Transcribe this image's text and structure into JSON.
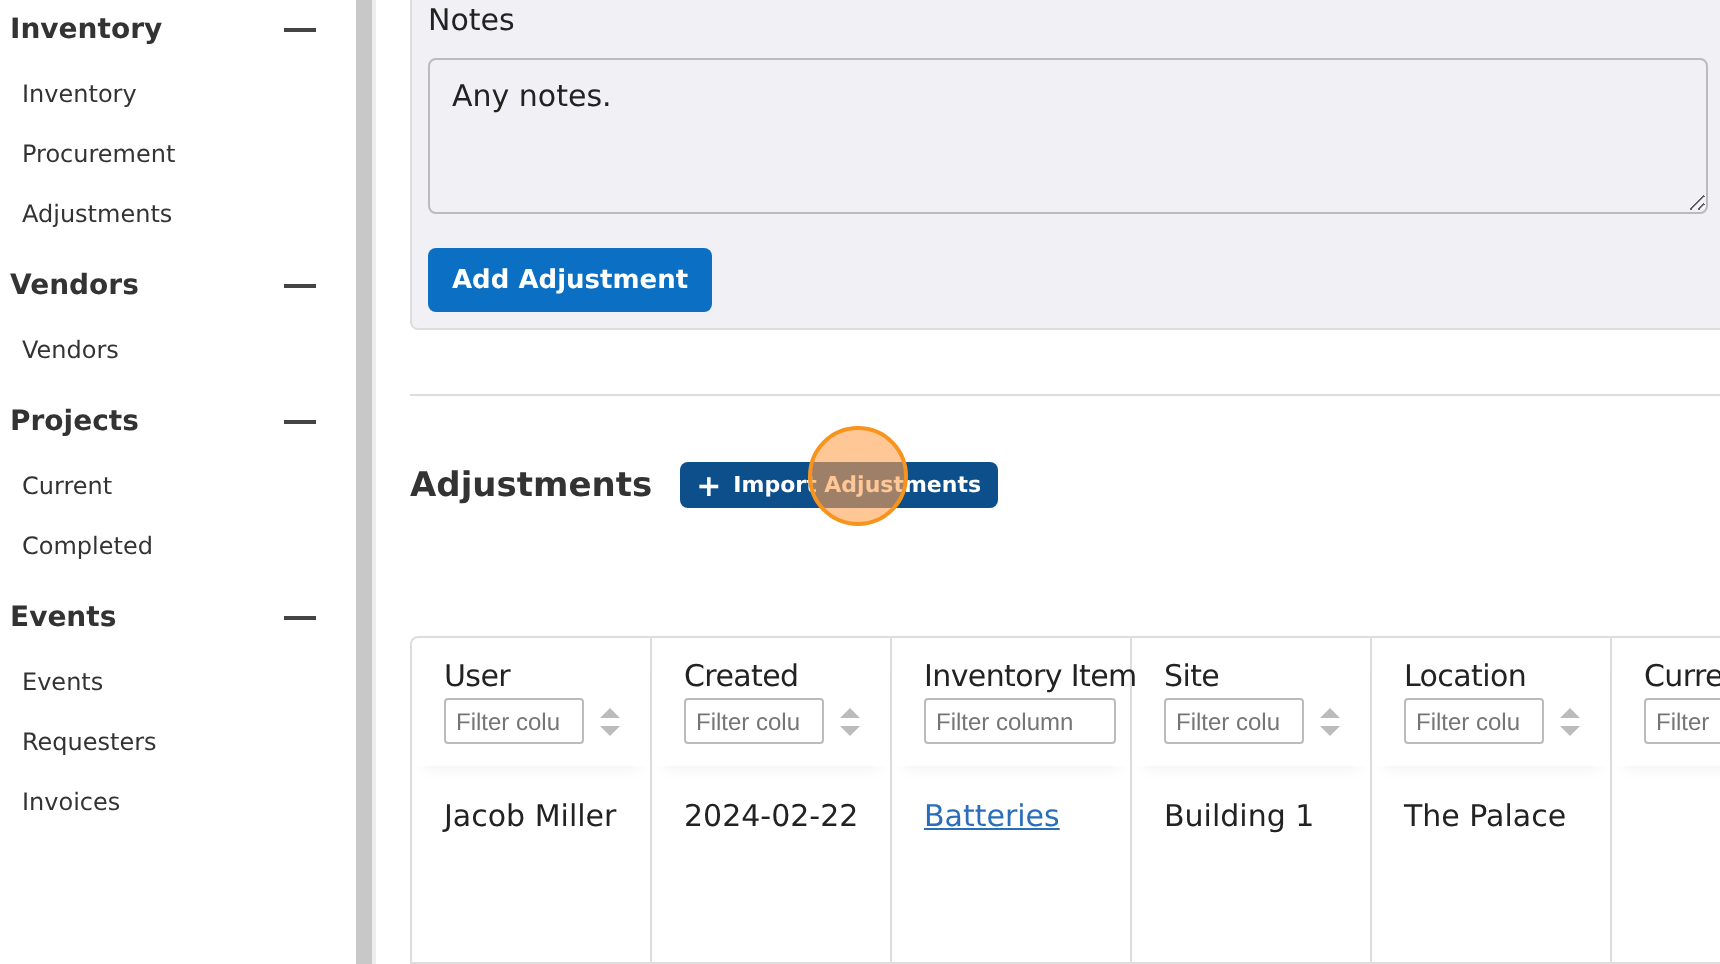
{
  "sidebar": {
    "sections": [
      {
        "title": "Inventory",
        "expanded": true,
        "items": [
          "Inventory",
          "Procurement",
          "Adjustments"
        ]
      },
      {
        "title": "Vendors",
        "expanded": true,
        "items": [
          "Vendors"
        ]
      },
      {
        "title": "Projects",
        "expanded": true,
        "items": [
          "Current",
          "Completed"
        ]
      },
      {
        "title": "Events",
        "expanded": true,
        "items": [
          "Events",
          "Requesters",
          "Invoices"
        ]
      }
    ]
  },
  "form": {
    "notes_label": "Notes",
    "notes_value": "Any notes.",
    "submit": "Add Adjustment"
  },
  "adjustments": {
    "title": "Adjustments",
    "import_button": {
      "icon": "+",
      "label": "Import Adjustments"
    },
    "table": {
      "columns": [
        {
          "label": "User",
          "placeholder": "Filter colu"
        },
        {
          "label": "Created",
          "placeholder": "Filter colu"
        },
        {
          "label": "Inventory Item",
          "placeholder": "Filter column"
        },
        {
          "label": "Site",
          "placeholder": "Filter colu"
        },
        {
          "label": "Location",
          "placeholder": "Filter colu"
        },
        {
          "label": "Curre",
          "placeholder": "Filter"
        }
      ],
      "rows": [
        [
          {
            "kind": "text",
            "text": "Jacob Miller"
          },
          {
            "kind": "text",
            "text": "2024-02-22"
          },
          {
            "kind": "link",
            "text": "Batteries"
          },
          {
            "kind": "text",
            "text": "Building 1"
          },
          {
            "kind": "text",
            "text": "The Palace"
          }
        ]
      ]
    }
  }
}
